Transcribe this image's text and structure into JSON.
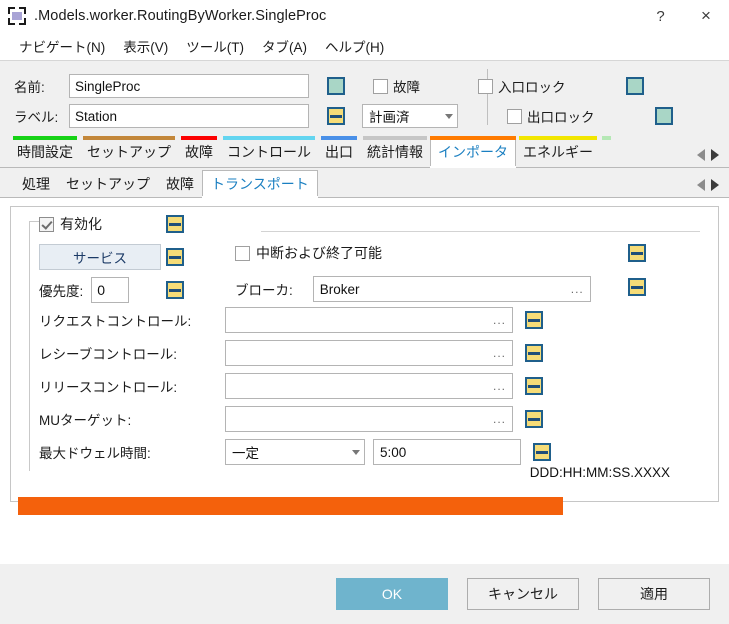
{
  "window": {
    "title": ".Models.worker.RoutingByWorker.SingleProc",
    "help_label": "?",
    "close_label": "×",
    "icon": "model-object-icon"
  },
  "menubar": {
    "items": [
      {
        "label": "ナビゲート(N)"
      },
      {
        "label": "表示(V)"
      },
      {
        "label": "ツール(T)"
      },
      {
        "label": "タブ(A)"
      },
      {
        "label": "ヘルプ(H)"
      }
    ]
  },
  "form": {
    "name_label": "名前:",
    "name_value": "SingleProc",
    "label_label": "ラベル:",
    "label_value": "Station",
    "failed_label": "故障",
    "failed_checked": false,
    "planned_value": "計画済",
    "entrance_lock_label": "入口ロック",
    "entrance_lock_checked": false,
    "exit_lock_label": "出口ロック",
    "exit_lock_checked": false,
    "toggles": {
      "name_toggle": "teal",
      "label_toggle": "yellow",
      "entrance_toggle": "teal",
      "exit_toggle": "teal"
    }
  },
  "tabs": {
    "items": [
      {
        "label": "時間設定",
        "color": "#16d216",
        "active": false
      },
      {
        "label": "セットアップ",
        "color": "#c3873a",
        "active": false
      },
      {
        "label": "故障",
        "color": "#fc0000",
        "active": false
      },
      {
        "label": "コントロール",
        "color": "#63d5f0",
        "active": false
      },
      {
        "label": "出口",
        "color": "#4a90e8",
        "active": false
      },
      {
        "label": "統計情報",
        "color": "#c6c6c6",
        "active": false
      },
      {
        "label": "インポータ",
        "color": "#ff7b00",
        "active": true
      },
      {
        "label": "エネルギー",
        "color": "#f2e600",
        "active": false
      }
    ],
    "overflow_stripe_color": "#b5e8b5",
    "nav_prev": "chevron-left-icon",
    "nav_next": "chevron-right-icon"
  },
  "subtabs": {
    "items": [
      {
        "label": "処理",
        "active": false
      },
      {
        "label": "セットアップ",
        "active": false
      },
      {
        "label": "故障",
        "active": false
      },
      {
        "label": "トランスポート",
        "active": true
      }
    ],
    "nav_prev": "chevron-left-icon",
    "nav_next": "chevron-right-icon"
  },
  "panel": {
    "enable_label": "有効化",
    "enable_checked": true,
    "service_button": "サービス",
    "priority_label": "優先度:",
    "priority_value": "0",
    "interruptible_label": "中断および終了可能",
    "interruptible_checked": false,
    "broker_label": "ブローカ:",
    "broker_value": "Broker",
    "rows": [
      {
        "label": "リクエストコントロール:",
        "value": "",
        "dots": "..."
      },
      {
        "label": "レシーブコントロール:",
        "value": "",
        "dots": "..."
      },
      {
        "label": "リリースコントロール:",
        "value": "",
        "dots": "..."
      },
      {
        "label": "MUターゲット:",
        "value": "",
        "dots": "..."
      }
    ],
    "dwell_label": "最大ドウェル時間:",
    "dwell_mode": "一定",
    "dwell_value": "5:00",
    "format_hint": "DDD:HH:MM:SS.XXXX",
    "dots": "..."
  },
  "footer": {
    "ok": "OK",
    "cancel": "キャンセル",
    "apply": "適用"
  },
  "colors": {
    "accent_blue": "#1a7fc1",
    "primary_button": "#6fb4cd",
    "toggle_yellow": "#f5dc78",
    "toggle_teal": "#a9d6c6",
    "toggle_border": "#1f5f8b",
    "highlight_orange": "#f4610c"
  }
}
